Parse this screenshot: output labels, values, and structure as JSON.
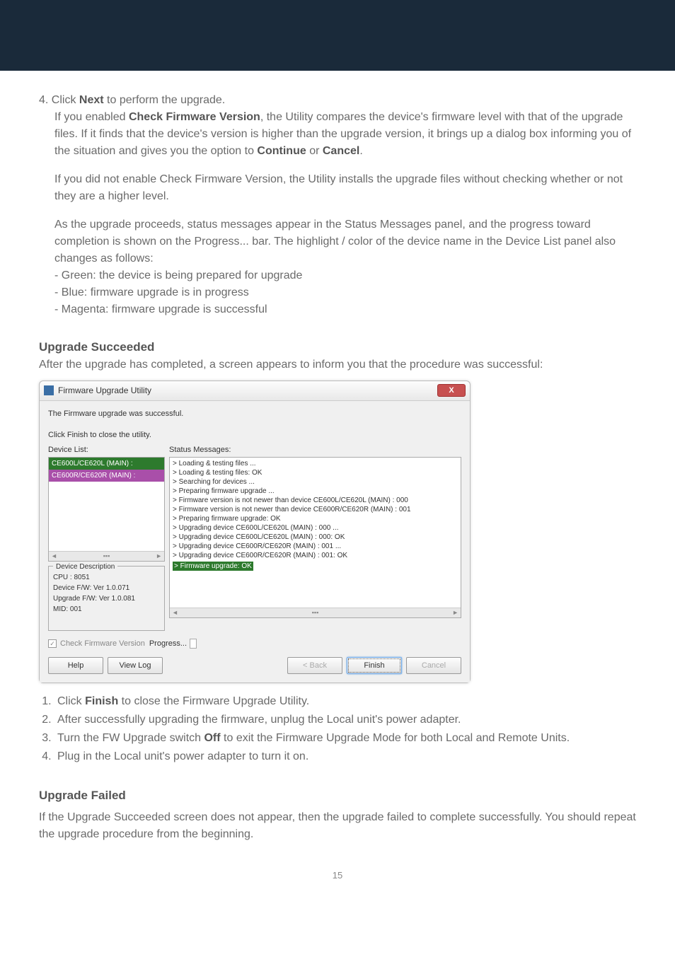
{
  "step4": {
    "line1_prefix": "4. Click ",
    "line1_bold": "Next",
    "line1_suffix": " to perform the upgrade.",
    "p1a": "If you enabled ",
    "p1b_bold": "Check Firmware Version",
    "p1c": ", the Utility compares the device's firmware level with that of the upgrade files. If it finds that the device's version is higher than the upgrade version, it brings up a dialog box informing you of the situation and gives you the option to ",
    "p1d_bold": "Continue",
    "p1e": " or ",
    "p1f_bold": "Cancel",
    "p1g": ".",
    "p2": "If you did not enable Check Firmware Version, the Utility installs the upgrade files without checking whether or not they are a higher level.",
    "p3": "As the upgrade proceeds, status messages appear in the Status Messages panel, and the progress toward completion is shown on the Progress... bar. The highlight / color of the device name in the Device List panel also changes as follows:",
    "b1": "- Green: the device is being prepared for upgrade",
    "b2": "- Blue: firmware upgrade is in progress",
    "b3": "- Magenta: firmware upgrade is successful"
  },
  "succeeded": {
    "heading": "Upgrade Succeeded",
    "intro": "After the upgrade has completed, a screen appears to inform you that the procedure was successful:"
  },
  "dialog": {
    "title": "Firmware Upgrade Utility",
    "close": "X",
    "msg1": "The Firmware upgrade was successful.",
    "msg2": "Click Finish to close the utility.",
    "device_list_label": "Device List:",
    "status_label": "Status Messages:",
    "devices": {
      "0": "CE600L/CE620L (MAIN) :",
      "1": "CE600R/CE620R (MAIN) :"
    },
    "desc_legend": "Device Description",
    "desc_cpu": "CPU : 8051",
    "desc_devfw": "Device F/W: Ver 1.0.071",
    "desc_upfw": "Upgrade F/W: Ver 1.0.081",
    "desc_mid": "MID: 001",
    "status": {
      "0": "> Loading & testing files ...",
      "1": "> Loading & testing files: OK",
      "2": "> Searching for devices ...",
      "3": "> Preparing firmware upgrade ...",
      "4": "> Firmware version is not newer than device CE600L/CE620L (MAIN) : 000",
      "5": "> Firmware version is not newer than device CE600R/CE620R (MAIN) : 001",
      "6": "> Preparing firmware upgrade: OK",
      "7": "> Upgrading device CE600L/CE620L (MAIN) : 000 ...",
      "8": "> Upgrading device CE600L/CE620L (MAIN) : 000: OK",
      "9": "> Upgrading device CE600R/CE620R (MAIN) : 001 ...",
      "10": "> Upgrading device CE600R/CE620R (MAIN) : 001: OK",
      "11": "> Firmware upgrade: OK"
    },
    "check_label": "Check Firmware Version",
    "progress_label": "Progress...",
    "help": "Help",
    "viewlog": "View Log",
    "back": "< Back",
    "finish": "Finish",
    "cancel": "Cancel",
    "scroll_left": "◄",
    "scroll_right": "►",
    "scroll_mid": "▪▪▪",
    "checkmark": "✓"
  },
  "final": {
    "s1a": "Click ",
    "s1b_bold": "Finish",
    "s1c": " to close the Firmware Upgrade Utility.",
    "s2": "After successfully upgrading the firmware, unplug the Local unit's power adapter.",
    "s3a": "Turn the FW Upgrade switch ",
    "s3b_bold": "Off",
    "s3c": " to exit the Firmware Upgrade Mode for both Local and Remote Units.",
    "s4": "Plug in the Local unit's power adapter to turn it on."
  },
  "failed": {
    "heading": "Upgrade Failed",
    "body": "If the Upgrade Succeeded screen does not appear, then the upgrade failed to complete successfully. You should repeat the upgrade procedure from the beginning."
  },
  "page": "15"
}
